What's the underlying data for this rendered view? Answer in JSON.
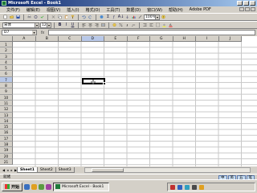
{
  "window": {
    "title": "Microsoft Excel - Book1"
  },
  "menu": [
    "文件(F)",
    "编辑(E)",
    "视图(V)",
    "插入(I)",
    "格式(O)",
    "工具(T)",
    "数据(D)",
    "窗口(W)",
    "帮助(H)",
    "Adobe PDF"
  ],
  "toolbar": {
    "zoom": "100%",
    "font_name": "宋体",
    "font_size": "12",
    "bold": "B",
    "italic": "I",
    "underline": "U",
    "sum": "Σ",
    "sort_az": "A↓"
  },
  "formula_bar": {
    "name_box": "D7",
    "fx": "fx",
    "content": ""
  },
  "grid": {
    "columns": [
      "A",
      "B",
      "C",
      "D",
      "E",
      "F",
      "G",
      "H",
      "I",
      "J"
    ],
    "rows": [
      "1",
      "2",
      "3",
      "4",
      "5",
      "6",
      "7",
      "8",
      "9",
      "10",
      "11",
      "12",
      "13",
      "14",
      "15",
      "16",
      "17",
      "18",
      "19",
      "20",
      "21"
    ],
    "active_cell": "D7",
    "active_column": "D",
    "active_row": "7"
  },
  "sheets": [
    "Sheet1",
    "Sheet2",
    "Sheet3"
  ],
  "active_sheet": "Sheet1",
  "status": "就绪",
  "ime": [
    "中",
    "英",
    "五",
    "笔"
  ],
  "taskbar": {
    "start_label": "开始",
    "task_item": "Microsoft Excel - Book1"
  },
  "icons": {
    "new": "new-doc-icon",
    "open": "open-folder-icon",
    "save": "save-disk-icon",
    "print": "printer-icon",
    "undo": "undo-icon",
    "redo": "redo-icon",
    "chart": "chart-icon",
    "help": "help-icon"
  }
}
